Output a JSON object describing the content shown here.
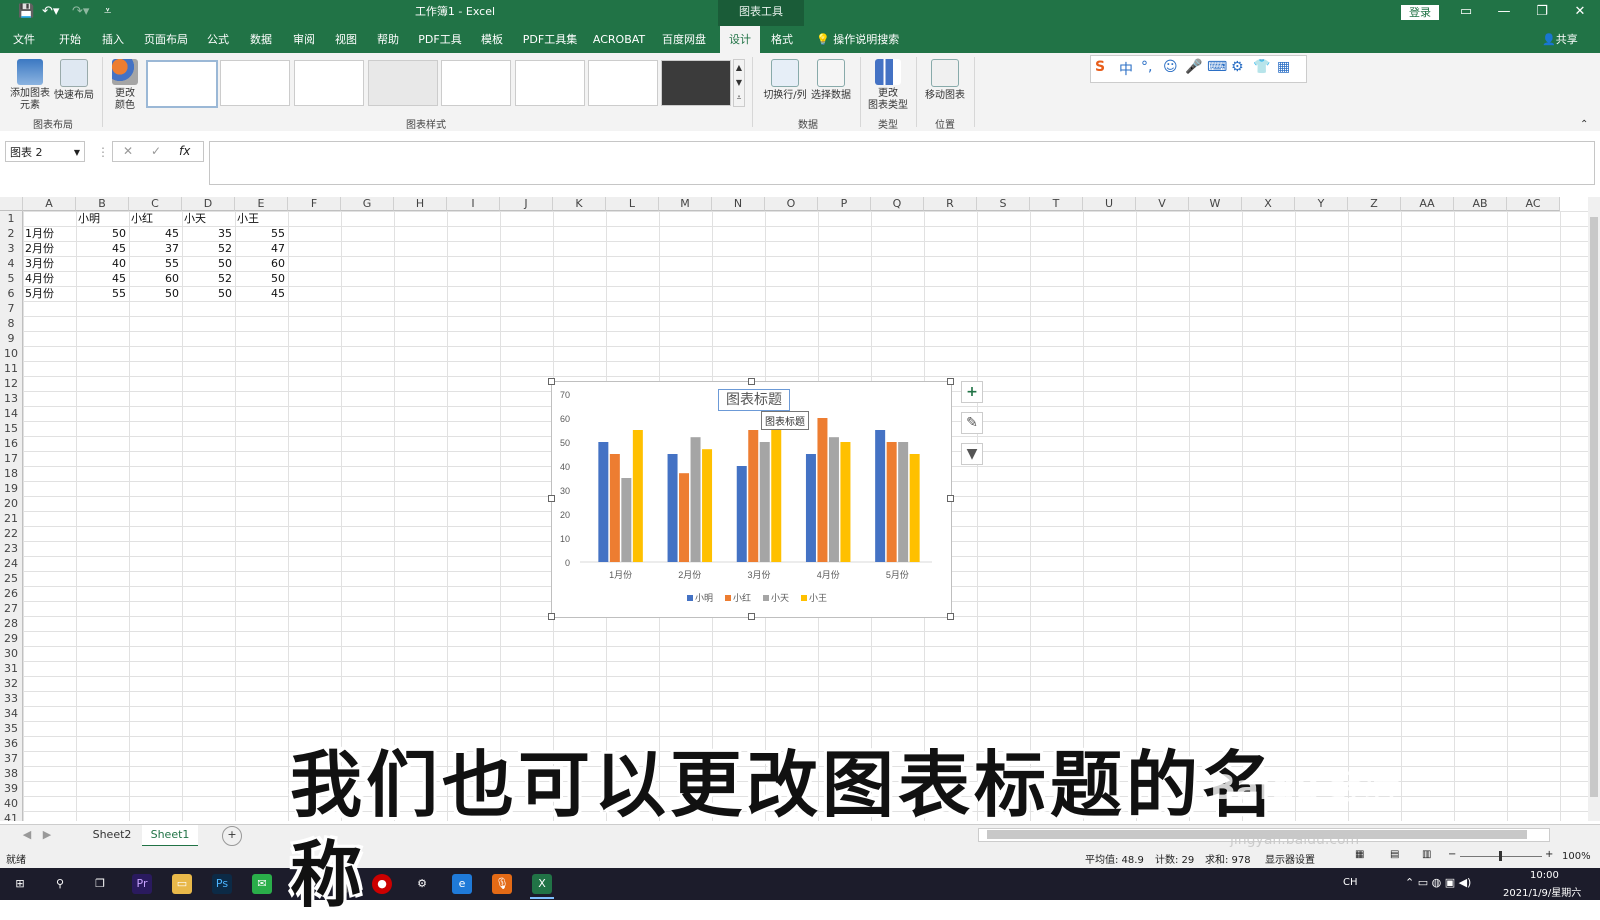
{
  "window": {
    "title": "工作簿1  -  Excel",
    "context_tab": "图表工具",
    "login": "登录",
    "controls": [
      "—",
      "❐",
      "✕"
    ]
  },
  "ribbon_tabs": [
    "文件",
    "开始",
    "插入",
    "页面布局",
    "公式",
    "数据",
    "审阅",
    "视图",
    "帮助",
    "PDF工具",
    "模板",
    "PDF工具集",
    "ACROBAT",
    "百度网盘",
    "设计",
    "格式"
  ],
  "active_tab": "设计",
  "tell_me": "操作说明搜索",
  "share": "共享",
  "ribbon": {
    "add_element": "添加图表\n元素",
    "quick_layout": "快速布局",
    "change_color": "更改\n颜色",
    "group_layout": "图表布局",
    "group_styles": "图表样式",
    "switch_row_col": "切换行/列",
    "select_data": "选择数据",
    "group_data": "数据",
    "change_type": "更改\n图表类型",
    "group_type": "类型",
    "move_chart": "移动图表",
    "group_location": "位置"
  },
  "ime_toolbar": [
    "S",
    "中",
    "°,",
    "☺",
    "🎤",
    "⌨",
    "⚙",
    "👕",
    "▦"
  ],
  "formula_bar": {
    "name_box": "图表 2",
    "cancel": "✕",
    "enter": "✓",
    "fx": "fx"
  },
  "columns": [
    "A",
    "B",
    "C",
    "D",
    "E",
    "F",
    "G",
    "H",
    "I",
    "J",
    "K",
    "L",
    "M",
    "N",
    "O",
    "P",
    "Q",
    "R",
    "S",
    "T",
    "U",
    "V",
    "W",
    "X",
    "Y",
    "Z",
    "AA",
    "AB",
    "AC"
  ],
  "rows": [
    "1",
    "2",
    "3",
    "4",
    "5",
    "6",
    "7",
    "8",
    "9",
    "10",
    "11",
    "12",
    "13",
    "14",
    "15",
    "16",
    "17",
    "18",
    "19",
    "20",
    "21",
    "22",
    "23",
    "24",
    "25",
    "26",
    "27",
    "28",
    "29",
    "30",
    "31",
    "32",
    "33",
    "34",
    "35",
    "36",
    "37",
    "38",
    "39",
    "40",
    "41"
  ],
  "table": {
    "headers": [
      "小明",
      "小红",
      "小天",
      "小王"
    ],
    "rows": [
      {
        "label": "1月份",
        "values": [
          "50",
          "45",
          "35",
          "55"
        ]
      },
      {
        "label": "2月份",
        "values": [
          "45",
          "37",
          "52",
          "47"
        ]
      },
      {
        "label": "3月份",
        "values": [
          "40",
          "55",
          "50",
          "60"
        ]
      },
      {
        "label": "4月份",
        "values": [
          "45",
          "60",
          "52",
          "50"
        ]
      },
      {
        "label": "5月份",
        "values": [
          "55",
          "50",
          "50",
          "45"
        ]
      }
    ]
  },
  "chart_data": {
    "type": "bar",
    "title": "图表标题",
    "tooltip": "图表标题",
    "categories": [
      "1月份",
      "2月份",
      "3月份",
      "4月份",
      "5月份"
    ],
    "series": [
      {
        "name": "小明",
        "color": "#4472c4",
        "values": [
          50,
          45,
          40,
          45,
          55
        ]
      },
      {
        "name": "小红",
        "color": "#ed7d31",
        "values": [
          45,
          37,
          55,
          60,
          50
        ]
      },
      {
        "name": "小天",
        "color": "#a5a5a5",
        "values": [
          35,
          52,
          50,
          52,
          50
        ]
      },
      {
        "name": "小王",
        "color": "#ffc000",
        "values": [
          55,
          47,
          60,
          50,
          45
        ]
      }
    ],
    "yticks": [
      "0",
      "10",
      "20",
      "30",
      "40",
      "50",
      "60",
      "70"
    ],
    "ylim": [
      0,
      70
    ],
    "legend": "bottom"
  },
  "chart_side_buttons": [
    "+",
    "✎",
    "▼"
  ],
  "sheet_tabs": [
    "Sheet2",
    "Sheet1"
  ],
  "active_sheet": "Sheet1",
  "add_sheet": "+",
  "status": {
    "ready": "就绪",
    "average": "平均值: 48.9",
    "count": "计数: 29",
    "sum": "求和: 978",
    "display_settings": "显示器设置",
    "zoom": "100%"
  },
  "taskbar": {
    "time": "10:00",
    "date": "2021/1/9/星期六",
    "lang": "CH"
  },
  "subtitle": "我们也可以更改图表标题的名称",
  "watermark": "Baidu 经验",
  "watermark_url": "jingyan.baidu.com",
  "colors": {
    "excel_green": "#217346"
  }
}
